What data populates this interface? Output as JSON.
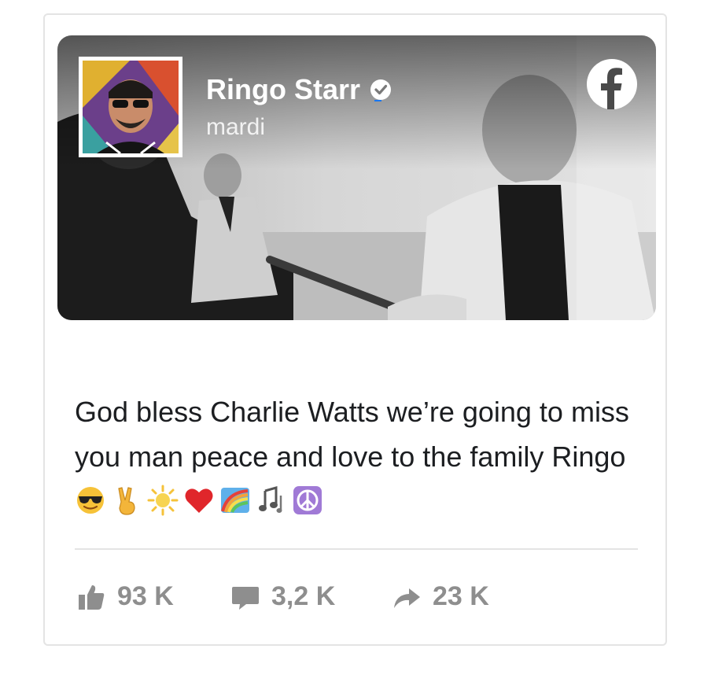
{
  "post": {
    "author": "Ringo Starr",
    "date": "mardi",
    "text": "God bless Charlie Watts we’re going to miss you man peace and love to the family Ringo",
    "emojis": [
      "smiling-face-with-sunglasses",
      "victory-hand",
      "sun",
      "red-heart",
      "rainbow",
      "musical-notes",
      "peace-symbol"
    ]
  },
  "stats": {
    "likes": "93 K",
    "comments": "3,2 K",
    "shares": "23 K"
  },
  "icons": {
    "brand": "facebook-icon",
    "verified": "verified-badge-icon",
    "like": "thumbs-up-icon",
    "comment": "speech-bubble-icon",
    "share": "share-arrow-icon"
  },
  "colors": {
    "facebook": "#ffffff",
    "text": "#1c1e21",
    "stats": "#8e8e8e",
    "verified": "#1877f2"
  }
}
